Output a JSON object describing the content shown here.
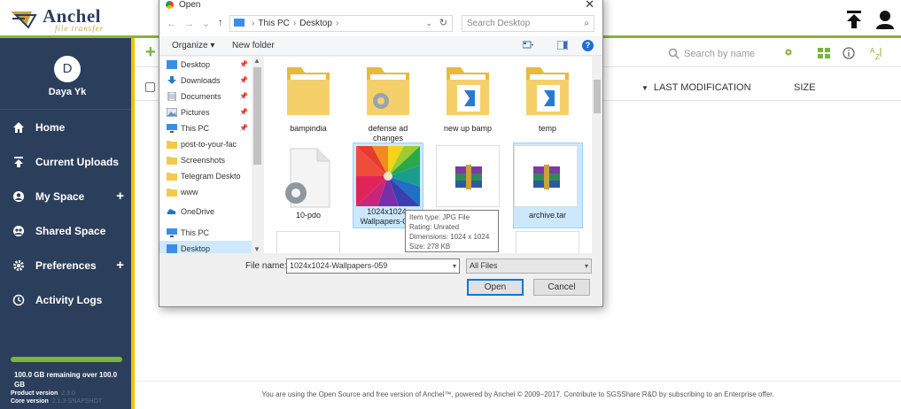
{
  "header": {
    "brand": "Anchel",
    "tagline": "file transfer"
  },
  "sidebar": {
    "avatar_initial": "D",
    "user_name": "Daya Yk",
    "items": [
      {
        "label": "Home",
        "icon": "home-icon",
        "has_plus": false
      },
      {
        "label": "Current Uploads",
        "icon": "upload-icon",
        "has_plus": false
      },
      {
        "label": "My Space",
        "icon": "person-icon",
        "has_plus": true
      },
      {
        "label": "Shared Space",
        "icon": "shared-icon",
        "has_plus": false
      },
      {
        "label": "Preferences",
        "icon": "gear-icon",
        "has_plus": true
      },
      {
        "label": "Activity Logs",
        "icon": "history-icon",
        "has_plus": false
      }
    ],
    "plus_label": "+",
    "storage_text": "100.0 GB remaining over 100.0 GB",
    "product_version_label": "Product version",
    "product_version_value": "2.3.0",
    "core_version_label": "Core version",
    "core_version_value": "2.1.3-SNAPSHOT",
    "storage_fraction_remaining": 1.0
  },
  "main": {
    "add_label": "+",
    "search_placeholder": "Search by name",
    "col_last_modification": "LAST MODIFICATION",
    "col_size": "SIZE",
    "footer_text": "You are using the Open Source and free version of Anchel™, powered by Anchel © 2009–2017. Contribute to SGSShare R&D by subscribing to an Enterprise offer."
  },
  "dialog": {
    "title": "Open",
    "close": "✕",
    "address": {
      "part1": "This PC",
      "part2": "Desktop"
    },
    "search_placeholder": "Search Desktop",
    "organize": "Organize ▾",
    "new_folder": "New folder",
    "help": "?",
    "nav_items": [
      {
        "label": "Desktop",
        "pinned": true,
        "type": "desktop"
      },
      {
        "label": "Downloads",
        "pinned": true,
        "type": "download"
      },
      {
        "label": "Documents",
        "pinned": true,
        "type": "doc"
      },
      {
        "label": "Pictures",
        "pinned": true,
        "type": "pic"
      },
      {
        "label": "This PC",
        "pinned": true,
        "type": "pc"
      },
      {
        "label": "post-to-your-fac",
        "pinned": false,
        "type": "folder"
      },
      {
        "label": "Screenshots",
        "pinned": false,
        "type": "folder"
      },
      {
        "label": "Telegram Deskto",
        "pinned": false,
        "type": "folder"
      },
      {
        "label": "www",
        "pinned": false,
        "type": "folder"
      },
      {
        "label": "OneDrive",
        "pinned": false,
        "type": "cloud"
      },
      {
        "label": "This PC",
        "pinned": false,
        "type": "pc"
      },
      {
        "label": "Desktop",
        "pinned": false,
        "type": "desktop",
        "selected": true
      }
    ],
    "files": [
      {
        "name": "bampindia",
        "kind": "folder"
      },
      {
        "name": "defense ad changes",
        "kind": "folder-gear"
      },
      {
        "name": "new up bamp",
        "kind": "folder-vs"
      },
      {
        "name": "temp",
        "kind": "folder-vs"
      },
      {
        "name": "10-pdo",
        "kind": "file-gear"
      },
      {
        "name": "1024x1024-Wallpapers-059",
        "kind": "image",
        "selected": true
      },
      {
        "name": "",
        "kind": "archive"
      },
      {
        "name": "archive.tar",
        "kind": "archive"
      }
    ],
    "tooltip": {
      "item_type": "Item type: JPG File",
      "rating": "Rating: Unrated",
      "dimensions": "Dimensions: 1024 x 1024",
      "size": "Size: 278 KB"
    },
    "file_name_label": "File name:",
    "file_name_value": "1024x1024-Wallpapers-059",
    "file_type": "All Files",
    "open_button": "Open",
    "cancel_button": "Cancel"
  }
}
